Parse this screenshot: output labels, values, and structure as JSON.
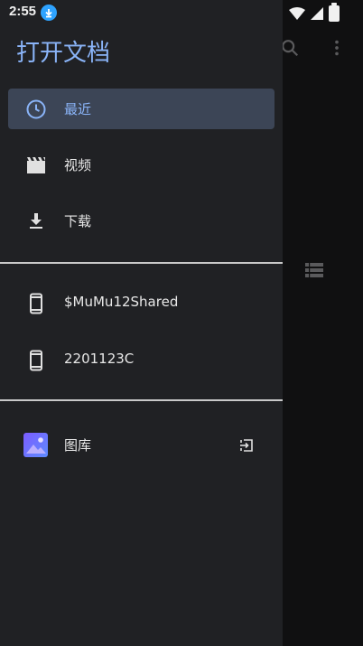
{
  "status_bar": {
    "time": "2:55"
  },
  "drawer": {
    "title": "打开文档",
    "roots": [
      {
        "label": "最近",
        "icon": "clock-icon",
        "active": true
      },
      {
        "label": "视频",
        "icon": "movie-icon",
        "active": false
      },
      {
        "label": "下载",
        "icon": "download-icon",
        "active": false
      }
    ],
    "devices": [
      {
        "label": "$MuMu12Shared",
        "icon": "phone-icon"
      },
      {
        "label": "2201123C",
        "icon": "phone-icon"
      }
    ],
    "apps": [
      {
        "label": "图库",
        "icon": "gallery-icon",
        "action_icon": "open-in-icon"
      }
    ]
  },
  "colors": {
    "drawer_bg": "#202124",
    "accent": "#8ab4f8",
    "active_bg": "#3c4556",
    "divider": "#c9c9c9"
  }
}
